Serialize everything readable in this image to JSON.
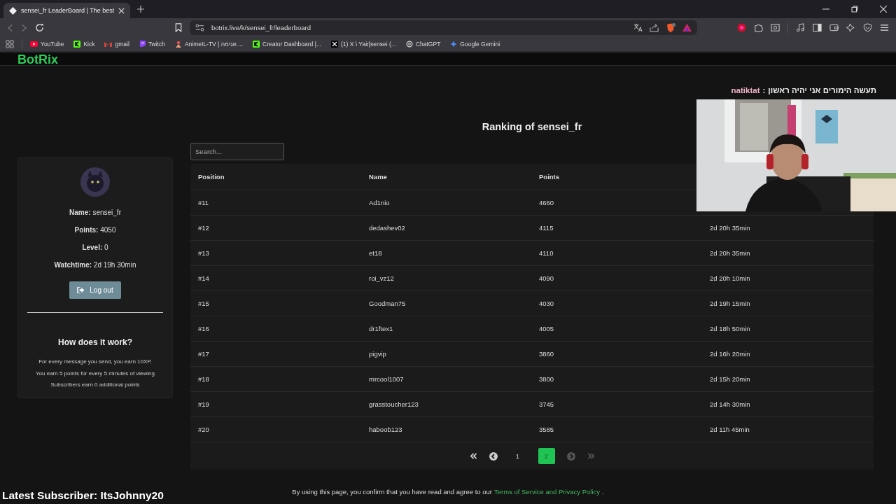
{
  "browser": {
    "tabs": [
      {
        "title": "sensei_fr LeaderBoard | The best",
        "selected": true
      }
    ],
    "url": "botrix.live/k/sensei_fr/leaderboard",
    "bookmarks": [
      {
        "label": "YouTube",
        "kind": "youtube"
      },
      {
        "label": "Kick",
        "kind": "kick"
      },
      {
        "label": "gmail",
        "kind": "gmail"
      },
      {
        "label": "Twitch",
        "kind": "twitch"
      },
      {
        "label": "AnimeIL-TV | אנימה....",
        "kind": "anime"
      },
      {
        "label": "Creator Dashboard |...",
        "kind": "kick"
      },
      {
        "label": "(1) X \\ Yair|sensei (...",
        "kind": "x"
      },
      {
        "label": "ChatGPT",
        "kind": "chatgpt"
      },
      {
        "label": "Google Gemini",
        "kind": "gemini"
      }
    ]
  },
  "page": {
    "logo": "BotRix",
    "title": "Ranking of sensei_fr",
    "search": {
      "placeholder": "Search..."
    },
    "profile": {
      "fields": [
        {
          "label": "Name:",
          "value": "sensei_fr"
        },
        {
          "label": "Points:",
          "value": "4050"
        },
        {
          "label": "Level:",
          "value": "0"
        },
        {
          "label": "Watchtime:",
          "value": "2d 19h 30min"
        }
      ],
      "logout": "Log out",
      "how_title": "How does it work?",
      "how_lines": [
        "For every message you send, you earn 10XP.",
        "You earn 5 points for every 5 minutes of viewing",
        "Subscribers earn 0 additional points"
      ]
    },
    "table": {
      "columns": [
        "Position",
        "Name",
        "Points"
      ],
      "rows": [
        {
          "position": "#11",
          "name": "Ad1nio",
          "points": "4660"
        },
        {
          "position": "#12",
          "name": "dedashev02",
          "points": "4115",
          "watchtime": "2d 20h 35min"
        },
        {
          "position": "#13",
          "name": "et18",
          "points": "4110",
          "watchtime": "2d 20h 35min"
        },
        {
          "position": "#14",
          "name": "roi_vz12",
          "points": "4090",
          "watchtime": "2d 20h 10min"
        },
        {
          "position": "#15",
          "name": "Goodman75",
          "points": "4030",
          "watchtime": "2d 19h 15min"
        },
        {
          "position": "#16",
          "name": "dr1ftex1",
          "points": "4005",
          "watchtime": "2d 18h 50min"
        },
        {
          "position": "#17",
          "name": "pigvip",
          "points": "3860",
          "watchtime": "2d 16h 20min"
        },
        {
          "position": "#18",
          "name": "mrcool1007",
          "points": "3800",
          "watchtime": "2d 15h 20min"
        },
        {
          "position": "#19",
          "name": "grasstoucher123",
          "points": "3745",
          "watchtime": "2d 14h 30min"
        },
        {
          "position": "#20",
          "name": "haboob123",
          "points": "3585",
          "watchtime": "2d 11h 45min"
        }
      ]
    },
    "pagination": [
      {
        "kind": "first",
        "disabled": false
      },
      {
        "kind": "prev",
        "disabled": false
      },
      {
        "kind": "page",
        "label": "1",
        "selected": false
      },
      {
        "kind": "page",
        "label": "2",
        "selected": true
      },
      {
        "kind": "next",
        "disabled": true
      },
      {
        "kind": "last",
        "disabled": true
      }
    ],
    "footer": {
      "text": "By using this page, you confirm that you have read and agree to our",
      "link": "Terms of Service and Privacy Policy",
      "end": "."
    }
  },
  "overlay": {
    "chat": {
      "user": "natiktat",
      "separator": ":",
      "message": "תעשה הימורים אני יהיה ראשון"
    },
    "latest_subscriber": "Latest Subscriber: ItsJohnny20"
  }
}
